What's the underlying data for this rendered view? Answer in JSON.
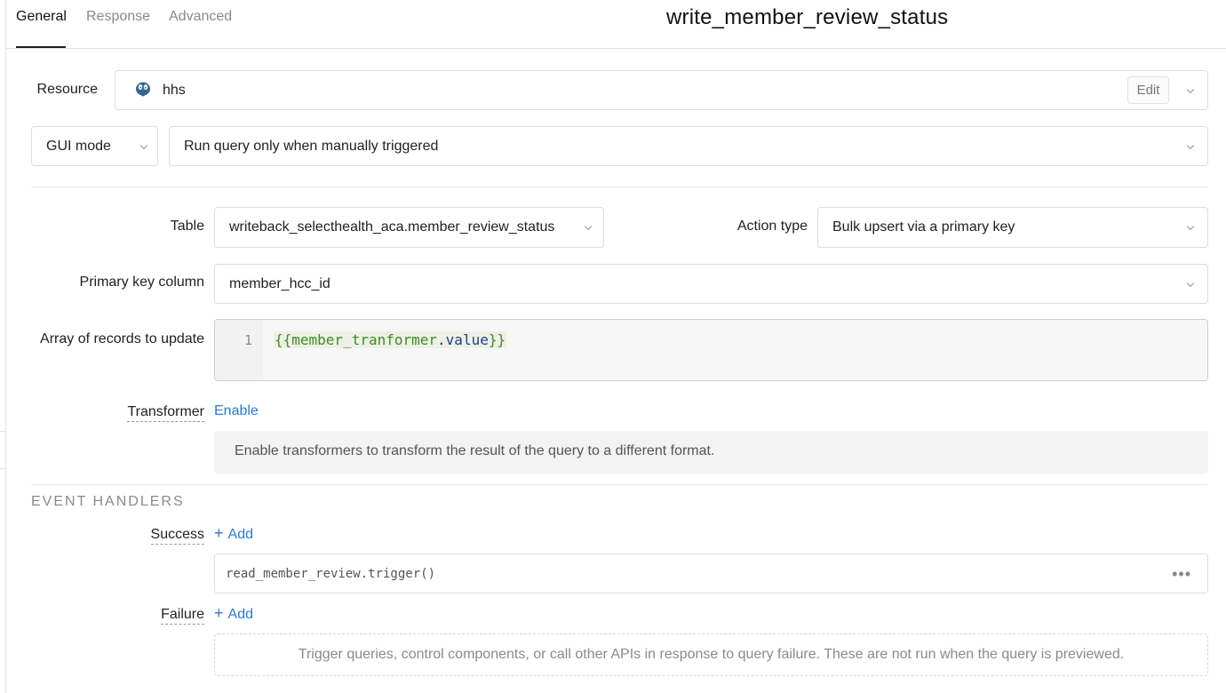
{
  "tabs": [
    {
      "label": "General",
      "active": true
    },
    {
      "label": "Response",
      "active": false
    },
    {
      "label": "Advanced",
      "active": false
    }
  ],
  "query_name": "write_member_review_status",
  "resource": {
    "label": "Resource",
    "value": "hhs",
    "icon": "postgresql-icon",
    "edit_label": "Edit"
  },
  "mode": {
    "value": "GUI mode"
  },
  "trigger": {
    "value": "Run query only when manually triggered"
  },
  "table": {
    "label": "Table",
    "value": "writeback_selecthealth_aca.member_review_status"
  },
  "action_type": {
    "label": "Action type",
    "value": "Bulk upsert via a primary key"
  },
  "primary_key": {
    "label": "Primary key column",
    "value": "member_hcc_id"
  },
  "records": {
    "label": "Array of records to update",
    "line_number": "1",
    "code": {
      "open": "{{",
      "var": "member_tranformer",
      "dot": ".",
      "prop": "value",
      "close": "}}"
    }
  },
  "transformer": {
    "label": "Transformer",
    "action": "Enable",
    "info": "Enable transformers to transform the result of the query to a different format."
  },
  "event_handlers": {
    "title": "EVENT HANDLERS",
    "success": {
      "label": "Success",
      "add": "Add",
      "handler": "read_member_review.trigger()"
    },
    "failure": {
      "label": "Failure",
      "add": "Add",
      "empty": "Trigger queries, control components, or call other APIs in response to query failure. These are not run when the query is previewed."
    }
  },
  "colors": {
    "link": "#2a7bd1",
    "code_green": "#3b8d26",
    "code_blue": "#1e3f8a"
  }
}
